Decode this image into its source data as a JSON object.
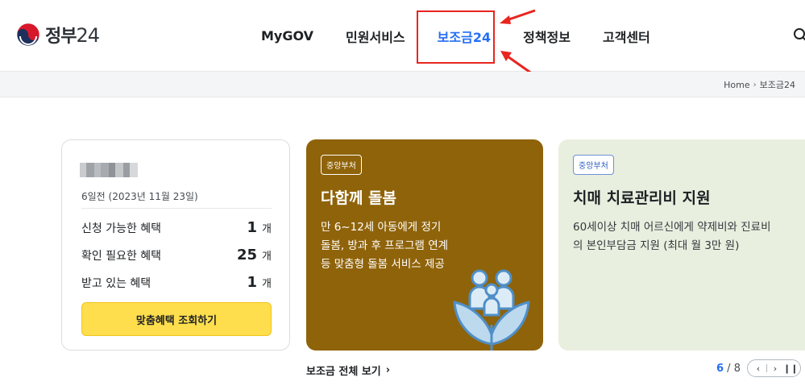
{
  "header": {
    "logo_text": "정부",
    "logo_num": "24",
    "nav": [
      "MyGOV",
      "민원서비스",
      "보조금24",
      "정책정보",
      "고객센터"
    ],
    "active_index": 2
  },
  "breadcrumb": {
    "home": "Home",
    "current": "보조금24"
  },
  "profile": {
    "visit_text": "6일전 (2023년 11월 23일)",
    "stats": [
      {
        "label": "신청 가능한 혜택",
        "value": "1",
        "unit": "개"
      },
      {
        "label": "확인 필요한 혜택",
        "value": "25",
        "unit": "개"
      },
      {
        "label": "받고 있는 혜택",
        "value": "1",
        "unit": "개"
      }
    ],
    "cta_label": "맞춤혜택 조회하기"
  },
  "banners": [
    {
      "badge": "중앙부처",
      "title": "다함께 돌봄",
      "desc_lines": [
        "만 6~12세 아동에게 정기",
        "돌봄, 방과 후 프로그램 연계",
        "등 맞춤형 돌봄 서비스 제공"
      ],
      "bg": "#8f6309"
    },
    {
      "badge": "중앙부처",
      "title": "치매 치료관리비 지원",
      "desc_lines": [
        "60세이상 치매 어르신에게 약제비와 진료비",
        "의 본인부담금 지원 (최대 월 3만 원)"
      ],
      "bg": "#e9efdf"
    }
  ],
  "view_all_label": "보조금 전체 보기",
  "pager": {
    "current": "6",
    "total": "8"
  },
  "colors": {
    "accent": "#256ef4",
    "highlight": "#e8251f",
    "cta": "#ffde4d"
  }
}
